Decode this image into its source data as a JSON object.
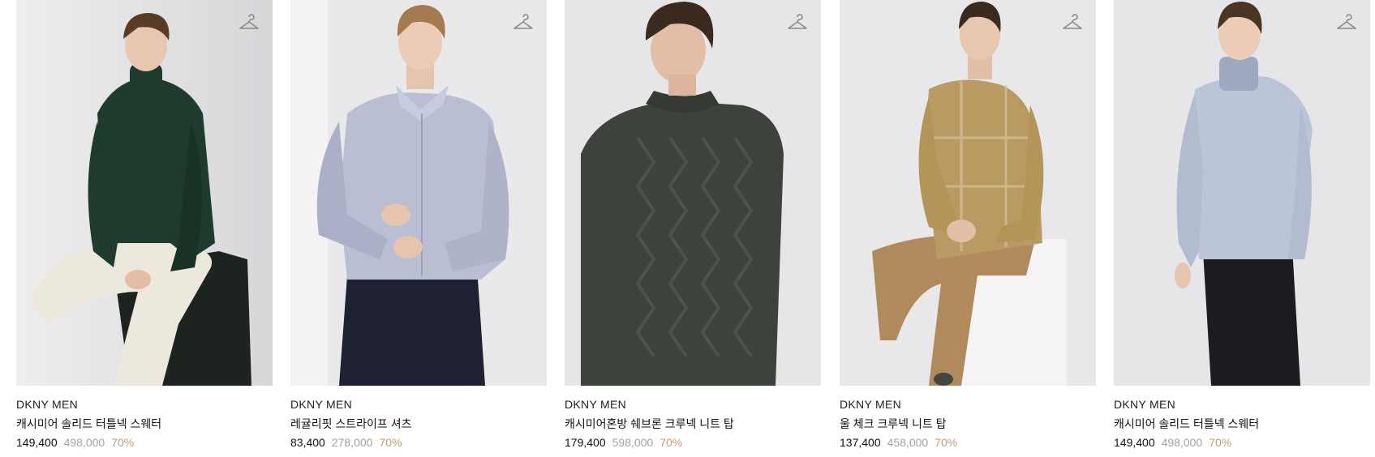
{
  "products": [
    {
      "brand": "DKNY MEN",
      "name": "캐시미어 솔리드 터틀넥 스웨터",
      "price": "149,400",
      "original_price": "498,000",
      "discount": "70%",
      "icon": "hanger-icon",
      "colors": {
        "background": "#e4e4e6",
        "top": "#1e3b2e",
        "bottom": "#ece8dd",
        "block": "#1d231f"
      }
    },
    {
      "brand": "DKNY MEN",
      "name": "레귤리핏 스트라이프 셔츠",
      "price": "83,400",
      "original_price": "278,000",
      "discount": "70%",
      "icon": "hanger-icon",
      "colors": {
        "background": "#e9e9ec",
        "top": "#b9bed3",
        "bottom": "#1d2131",
        "block": "#f2f2f4"
      }
    },
    {
      "brand": "DKNY MEN",
      "name": "캐시미어혼방 쉐브론 크루넥 니트 탑",
      "price": "179,400",
      "original_price": "598,000",
      "discount": "70%",
      "icon": "hanger-icon",
      "colors": {
        "background": "#e6e6e8",
        "top": "#3d423d",
        "bottom": "#2e312e",
        "block": "#ececee"
      }
    },
    {
      "brand": "DKNY MEN",
      "name": "울 체크 크루넥 니트 탑",
      "price": "137,400",
      "original_price": "458,000",
      "discount": "70%",
      "icon": "hanger-icon",
      "colors": {
        "background": "#e8e8ea",
        "top": "#b89a62",
        "bottom": "#b08a5c",
        "block": "#f4f4f4"
      }
    },
    {
      "brand": "DKNY MEN",
      "name": "캐시미어 솔리드 터틀넥 스웨터",
      "price": "149,400",
      "original_price": "498,000",
      "discount": "70%",
      "icon": "hanger-icon",
      "colors": {
        "background": "#e6e6e9",
        "top": "#bcc4d8",
        "bottom": "#1b1b20",
        "block": "#ececee"
      }
    }
  ]
}
